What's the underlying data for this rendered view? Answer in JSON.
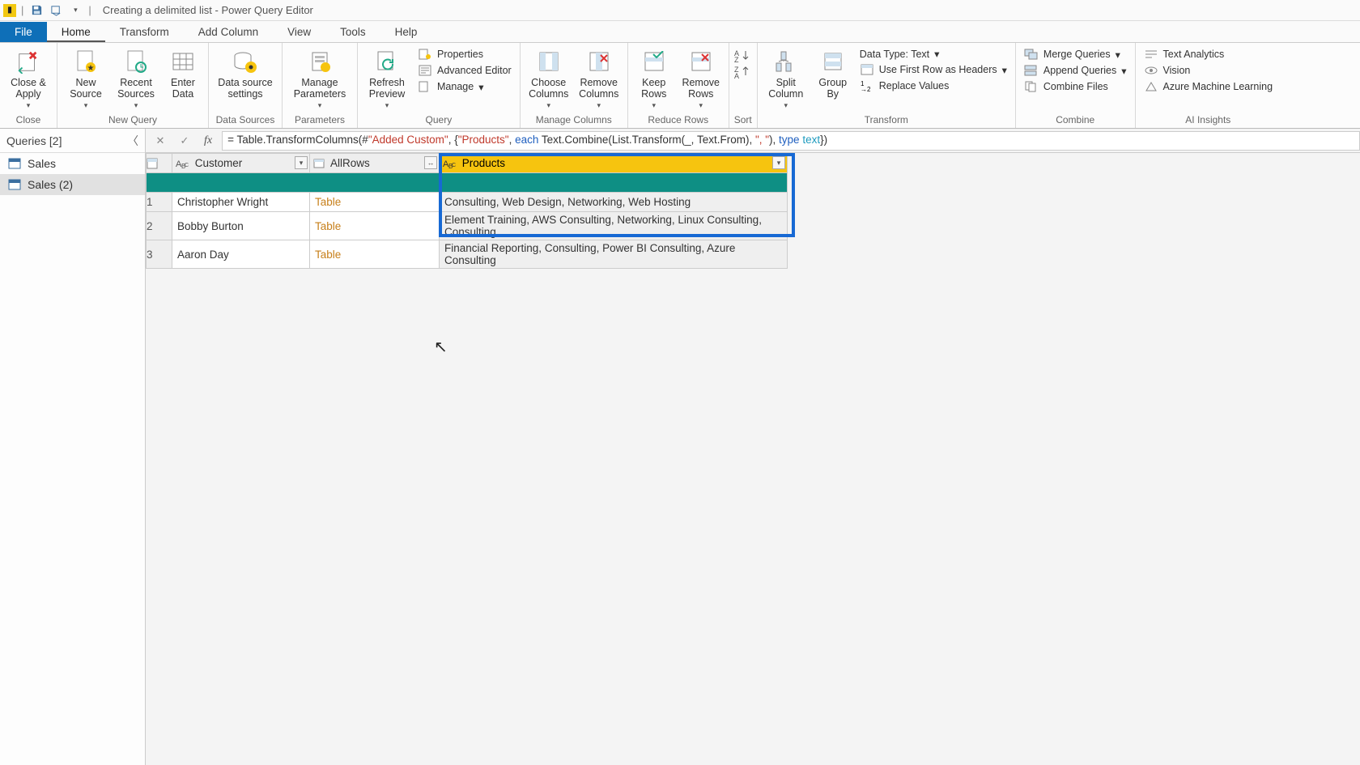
{
  "title": "Creating a delimited list - Power Query Editor",
  "tabs": {
    "file": "File",
    "home": "Home",
    "transform": "Transform",
    "addcol": "Add Column",
    "view": "View",
    "tools": "Tools",
    "help": "Help"
  },
  "ribbon": {
    "close": {
      "btn": "Close &\nApply",
      "label": "Close"
    },
    "newquery": {
      "new": "New\nSource",
      "recent": "Recent\nSources",
      "enter": "Enter\nData",
      "label": "New Query"
    },
    "datasources": {
      "btn": "Data source\nsettings",
      "label": "Data Sources"
    },
    "parameters": {
      "btn": "Manage\nParameters",
      "label": "Parameters"
    },
    "query": {
      "refresh": "Refresh\nPreview",
      "props": "Properties",
      "adv": "Advanced Editor",
      "manage": "Manage",
      "label": "Query"
    },
    "managecols": {
      "choose": "Choose\nColumns",
      "remove": "Remove\nColumns",
      "label": "Manage Columns"
    },
    "reducerows": {
      "keep": "Keep\nRows",
      "removerows": "Remove\nRows",
      "label": "Reduce Rows"
    },
    "sort": {
      "label": "Sort"
    },
    "transform": {
      "split": "Split\nColumn",
      "group": "Group\nBy",
      "dtype": "Data Type: Text",
      "first": "Use First Row as Headers",
      "replace": "Replace Values",
      "label": "Transform"
    },
    "combine": {
      "merge": "Merge Queries",
      "append": "Append Queries",
      "combinefiles": "Combine Files",
      "label": "Combine"
    },
    "ai": {
      "text": "Text Analytics",
      "vision": "Vision",
      "azure": "Azure Machine Learning",
      "label": "AI Insights"
    }
  },
  "queries": {
    "title": "Queries [2]",
    "items": [
      {
        "label": "Sales"
      },
      {
        "label": "Sales (2)"
      }
    ],
    "selected": 1
  },
  "formula": {
    "prefix": "= Table.TransformColumns(#",
    "added": "\"Added Custom\"",
    "mid1": ", {",
    "products": "\"Products\"",
    "mid2": ", ",
    "each": "each",
    "mid3": " Text.Combine(List.Transform(_, Text.From), ",
    "sep": "\", \"",
    "mid4": "), ",
    "type": "type",
    "mid5": " ",
    "text": "text",
    "end": "})"
  },
  "grid": {
    "columns": [
      {
        "name": "Customer"
      },
      {
        "name": "AllRows"
      },
      {
        "name": "Products"
      }
    ],
    "rows": [
      {
        "n": "1",
        "customer": "Christopher Wright",
        "allrows": "Table",
        "products": "Consulting, Web Design, Networking, Web Hosting"
      },
      {
        "n": "2",
        "customer": "Bobby Burton",
        "allrows": "Table",
        "products": "Element Training, AWS Consulting, Networking, Linux Consulting, Consulting"
      },
      {
        "n": "3",
        "customer": "Aaron Day",
        "allrows": "Table",
        "products": "Financial Reporting, Consulting, Power BI Consulting, Azure Consulting"
      }
    ]
  }
}
